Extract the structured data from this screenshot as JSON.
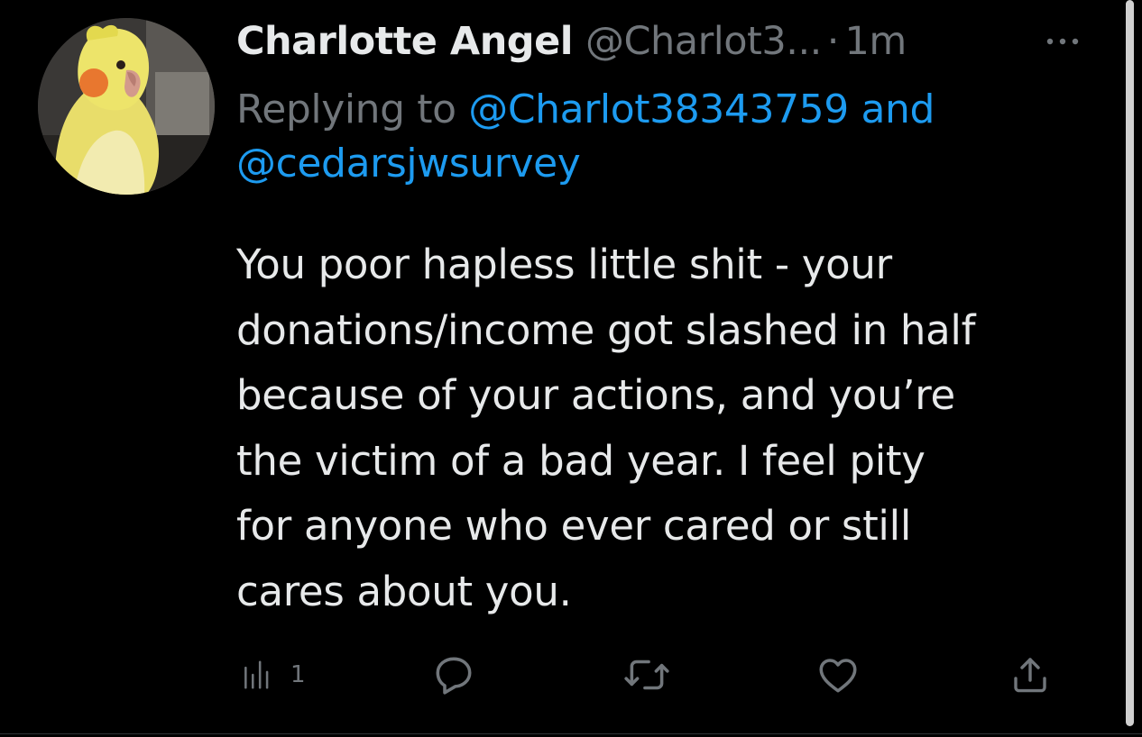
{
  "tweet": {
    "display_name": "Charlotte Angel",
    "handle": "@Charlot3...",
    "separator": "·",
    "time": "1m",
    "more_icon": "more-horizontal-icon",
    "reply": {
      "prefix": "Replying to ",
      "mention_1": "@Charlot38343759",
      "joiner": " and",
      "mention_2": "@cedarsjwsurvey"
    },
    "text": "You poor hapless little shit - your\ndonations/income got slashed in half\nbecause of your actions, and you’re\nthe victim of a bad year.  I feel pity\nfor anyone who ever cared or still\ncares about you."
  },
  "actions": {
    "views": {
      "icon": "analytics-icon",
      "count": "1"
    },
    "reply": {
      "icon": "reply-icon"
    },
    "retweet": {
      "icon": "retweet-icon"
    },
    "like": {
      "icon": "heart-icon"
    },
    "share": {
      "icon": "share-icon"
    }
  },
  "colors": {
    "background": "#000000",
    "primary_text": "#e7e9ea",
    "secondary_text": "#71767b",
    "accent": "#1d9bf0"
  }
}
